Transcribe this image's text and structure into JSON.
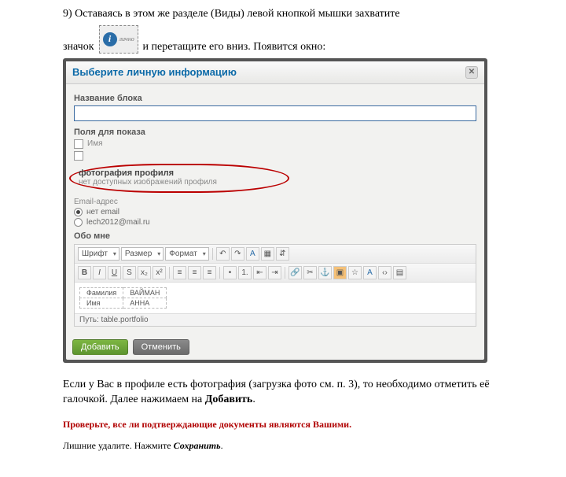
{
  "step": {
    "line1": "9) Оставаясь в этом же разделе (Виды)  левой кнопкой мышки захватите",
    "word_icon": "значок",
    "drag_hint": "лично",
    "line2_rest": "и перетащите его вниз. Появится окно:"
  },
  "dialog": {
    "title": "Выберите личную информацию",
    "block_name_label": "Название блока",
    "block_name_value": "",
    "fields_label": "Поля для показа",
    "chk_name": "Имя",
    "photo_section": {
      "title": "фотография профиля",
      "subtitle": "нет доступных изображений профиля"
    },
    "email": {
      "label": "Email-адрес",
      "opt_none": "нет email",
      "opt_value": "lech2012@mail.ru"
    },
    "about_label": "Обо мне",
    "toolbar": {
      "font": "Шрифт",
      "size": "Размер",
      "format": "Формат"
    },
    "table": {
      "r1c1": "Фамилия",
      "r1c2": "ВАЙМАН",
      "r2c1": "Имя",
      "r2c2": "АННА"
    },
    "status_path": "Путь: table.portfolio",
    "btn_add": "Добавить",
    "btn_cancel": "Отменить"
  },
  "after": {
    "para": "Если у Вас в профиле есть фотография (загрузка фото см. п. 3), то необходимо отметить её галочкой. Далее нажимаем на ",
    "para_bold": "Добавить",
    "red": "Проверьте, все ли подтверждающие документы являются Вашими.",
    "small_a": "Лишние удалите. Нажмите ",
    "small_b": "Сохранить",
    "small_c": "."
  }
}
